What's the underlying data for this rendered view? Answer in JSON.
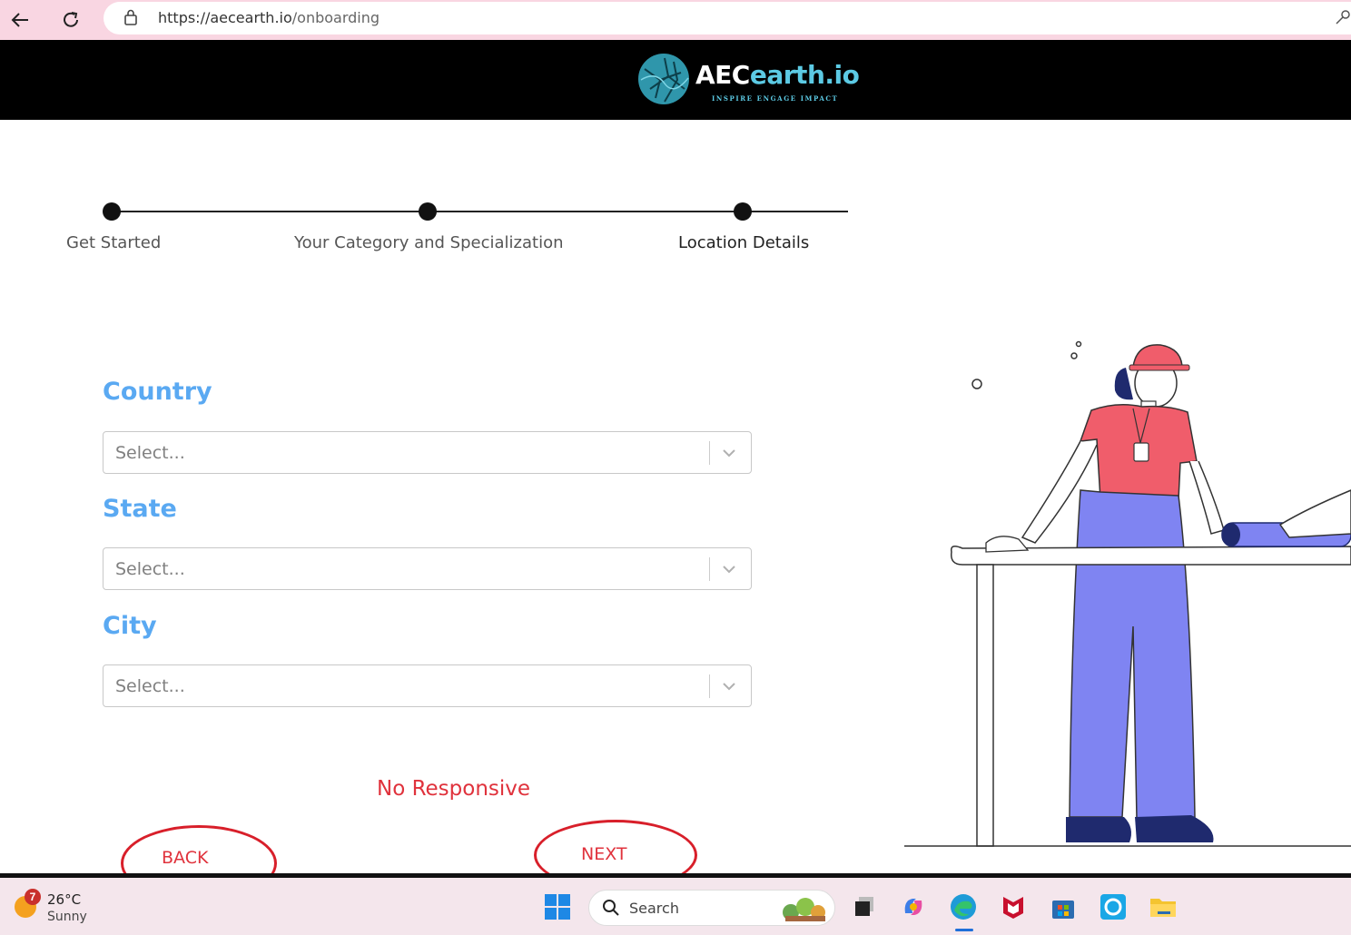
{
  "browser": {
    "url_host": "https://aecearth.io",
    "url_path": "/onboarding"
  },
  "header": {
    "logo_text_1": "AEC",
    "logo_text_2": "earth.io",
    "logo_tagline": "INSPIRE ENGAGE IMPACT"
  },
  "stepper": {
    "steps": [
      {
        "label": "Get Started"
      },
      {
        "label": "Your Category and Specialization"
      },
      {
        "label": "Location Details"
      }
    ]
  },
  "form": {
    "country": {
      "label": "Country",
      "placeholder": "Select..."
    },
    "state": {
      "label": "State",
      "placeholder": "Select..."
    },
    "city": {
      "label": "City",
      "placeholder": "Select..."
    }
  },
  "annotations": {
    "no_responsive": "No Responsive",
    "back": "BACK",
    "next": "NEXT"
  },
  "taskbar": {
    "weather_badge": "7",
    "temperature": "26°C",
    "condition": "Sunny",
    "search_label": "Search"
  },
  "colors": {
    "label_blue": "#5aa9f2",
    "annotation_red": "#e0323c",
    "header_black": "#000000",
    "logo_teal": "#5ccae4",
    "browser_pink": "#f9d6e2"
  }
}
